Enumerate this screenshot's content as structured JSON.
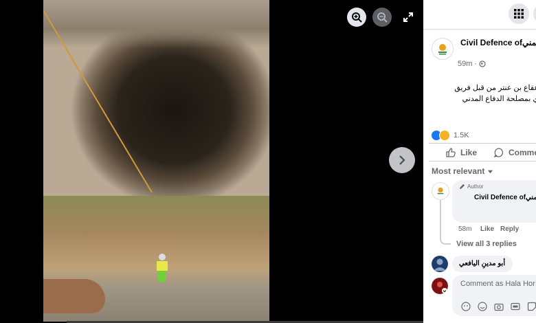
{
  "viewer": {
    "zoom_in_icon": "zoom-in-icon",
    "zoom_out_icon": "zoom-out-icon",
    "expand_icon": "expand-icon",
    "next_icon": "chevron-right-icon"
  },
  "post": {
    "page_name": "Civil Defence ofيمني",
    "time": "59m",
    "audience_icon": "globe-icon",
    "text_line_1": "عقاع بن عنتر من قبل فريق",
    "text_line_2": "ي بمصلحة الدفاع المدني",
    "reaction_count": "1.5K",
    "like_label": "Like",
    "comment_label": "Comme"
  },
  "comments": {
    "sort_label": "Most relevant",
    "first": {
      "author_tag": "Author",
      "name": "Civil Defence ofيمني",
      "time": "58m",
      "like": "Like",
      "reply": "Reply",
      "view_replies": "View all 3 replies"
    },
    "second": {
      "name": "أبو مدينِ اليافعي"
    },
    "composer_placeholder": "Comment as Hala Hor"
  },
  "colors": {
    "accent": "#1877f2",
    "secondary_text": "#65676b",
    "bubble": "#f0f2f5"
  }
}
